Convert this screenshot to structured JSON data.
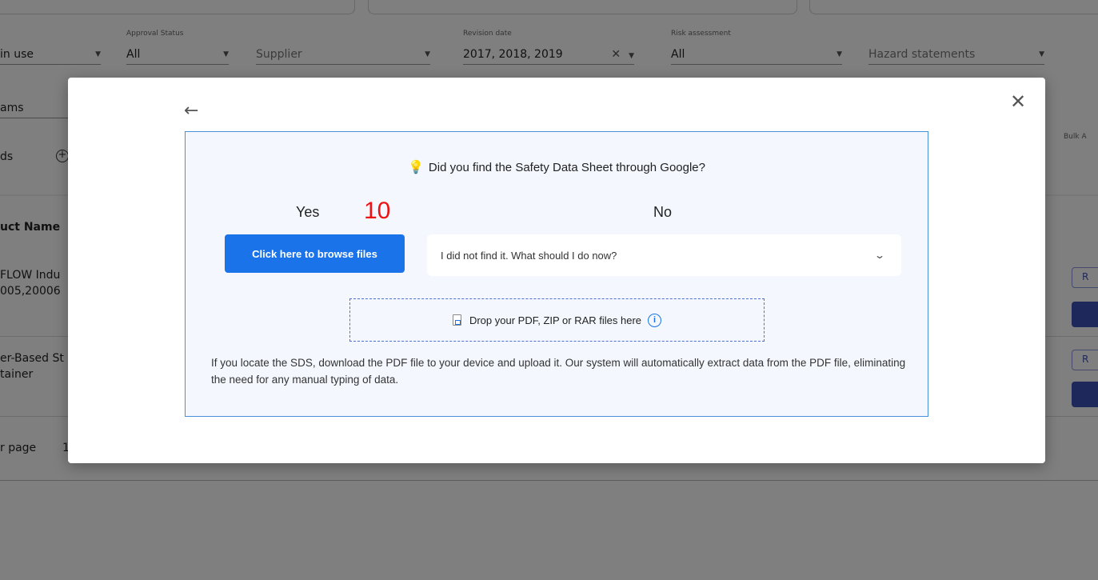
{
  "background": {
    "filters": {
      "in_use": "in use",
      "approval_status_label": "Approval Status",
      "approval_status_value": "All",
      "supplier_placeholder": "Supplier",
      "revision_date_label": "Revision date",
      "revision_date_value": "2017, 2018, 2019",
      "risk_assessment_label": "Risk assessment",
      "risk_assessment_value": "All",
      "hazard_statements_placeholder": "Hazard statements",
      "pictograms_fragment": "ams",
      "fields_fragment": "ds"
    },
    "bulk_label": "Bulk A",
    "product_name_header": "uct Name",
    "rows": [
      {
        "line1": "FLOW Indu",
        "line2": "005,20006",
        "button": "R"
      },
      {
        "line1": "er-Based St",
        "line2": "tainer",
        "button": "R"
      }
    ],
    "per_page": "r page",
    "per_page_value": "1"
  },
  "modal": {
    "question": "Did you find the Safety Data Sheet through Google?",
    "yes_label": "Yes",
    "step_number": "10",
    "no_label": "No",
    "browse_button": "Click here to browse files",
    "no_dropdown_text": "I did not find it. What should I do now?",
    "dropzone_text": "Drop your PDF, ZIP or RAR files here",
    "help_text": "If you locate the SDS, download the PDF file to your device and upload it. Our system will automatically extract data from the PDF file, eliminating the need for any manual typing of data."
  },
  "icons": {
    "back": "arrow-left-icon",
    "close": "close-icon",
    "bulb": "lightbulb-icon",
    "chevron": "chevron-down-icon",
    "file": "file-icon",
    "info": "info-icon"
  },
  "colors": {
    "primary": "#1a73e8",
    "step_number": "#ee1111",
    "panel_border": "#4a90d9",
    "panel_bg": "#f4f8fe",
    "bg_button": "#3f51b5"
  }
}
